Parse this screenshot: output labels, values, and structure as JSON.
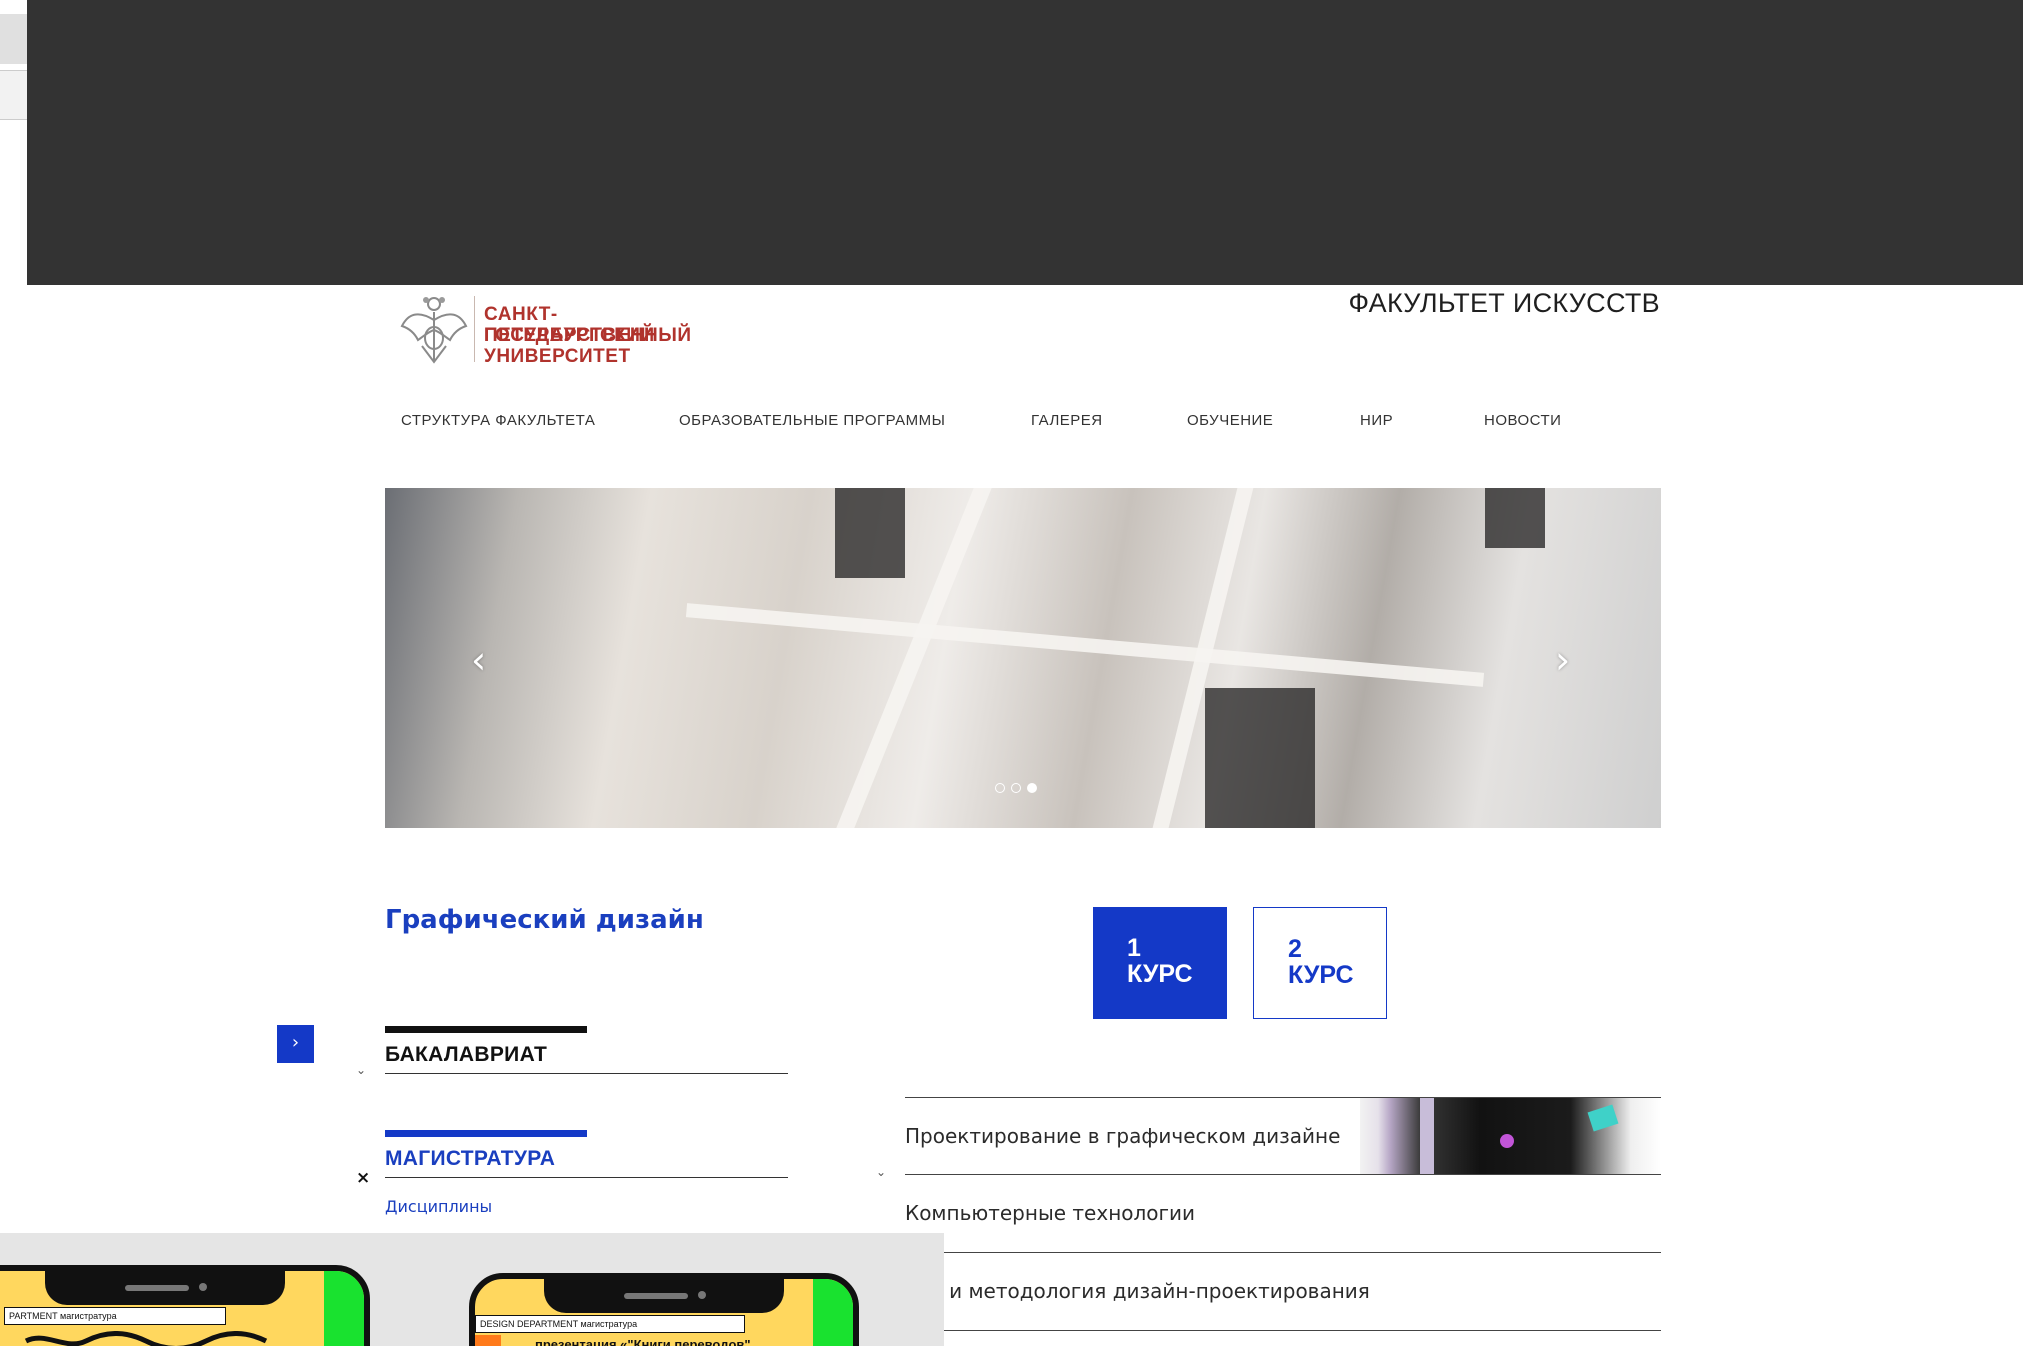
{
  "header": {
    "university_lines": [
      "САНКТ-ПЕТЕРБУРГСКИЙ",
      "ГОСУДАРСТВЕННЫЙ",
      "УНИВЕРСИТЕТ"
    ],
    "faculty_title": "ФАКУЛЬТЕТ ИСКУССТВ"
  },
  "nav": {
    "items": [
      {
        "label": "СТРУКТУРА ФАКУЛЬТЕТА"
      },
      {
        "label": "ОБРАЗОВАТЕЛЬНЫЕ ПРОГРАММЫ"
      },
      {
        "label": "ГАЛЕРЕЯ"
      },
      {
        "label": "ОБУЧЕНИЕ"
      },
      {
        "label": "НИР"
      },
      {
        "label": "НОВОСТИ"
      }
    ]
  },
  "hero": {
    "prev_icon": "‹",
    "next_icon": "›",
    "slide_count": 3,
    "active_slide": 3
  },
  "program": {
    "title": "Графический дизайн",
    "courses": [
      {
        "number": "1",
        "label": "КУРС",
        "active": true
      },
      {
        "number": "2",
        "label": "КУРС",
        "active": false
      }
    ]
  },
  "sidebar": {
    "toggle_icon": "›",
    "sections": [
      {
        "label": "БАКАЛАВРИАТ",
        "color": "#111111",
        "bar_color": "#111111"
      },
      {
        "label": "МАГИСТРАТУРА",
        "color": "#1a3fbf",
        "bar_color": "#1439c7"
      }
    ],
    "close_icon": "×",
    "sub_link": "Дисциплины",
    "chevron": "⌄"
  },
  "disciplines": [
    {
      "label": "Проектирование в графическом дизайне"
    },
    {
      "label": "Компьютерные технологии"
    },
    {
      "label": "рия и методология дизайн-проектирования"
    }
  ],
  "bottom_preview": {
    "phone1_bar": "PARTMENT   магистратура",
    "phone2_bar": "DESIGN DEPARTMENT   магистратура",
    "phone2_caption": "презентация «\"Книги переводов\""
  },
  "colors": {
    "accent_blue": "#1439c7",
    "brand_red": "#b0332d",
    "topbar": "#333333"
  }
}
